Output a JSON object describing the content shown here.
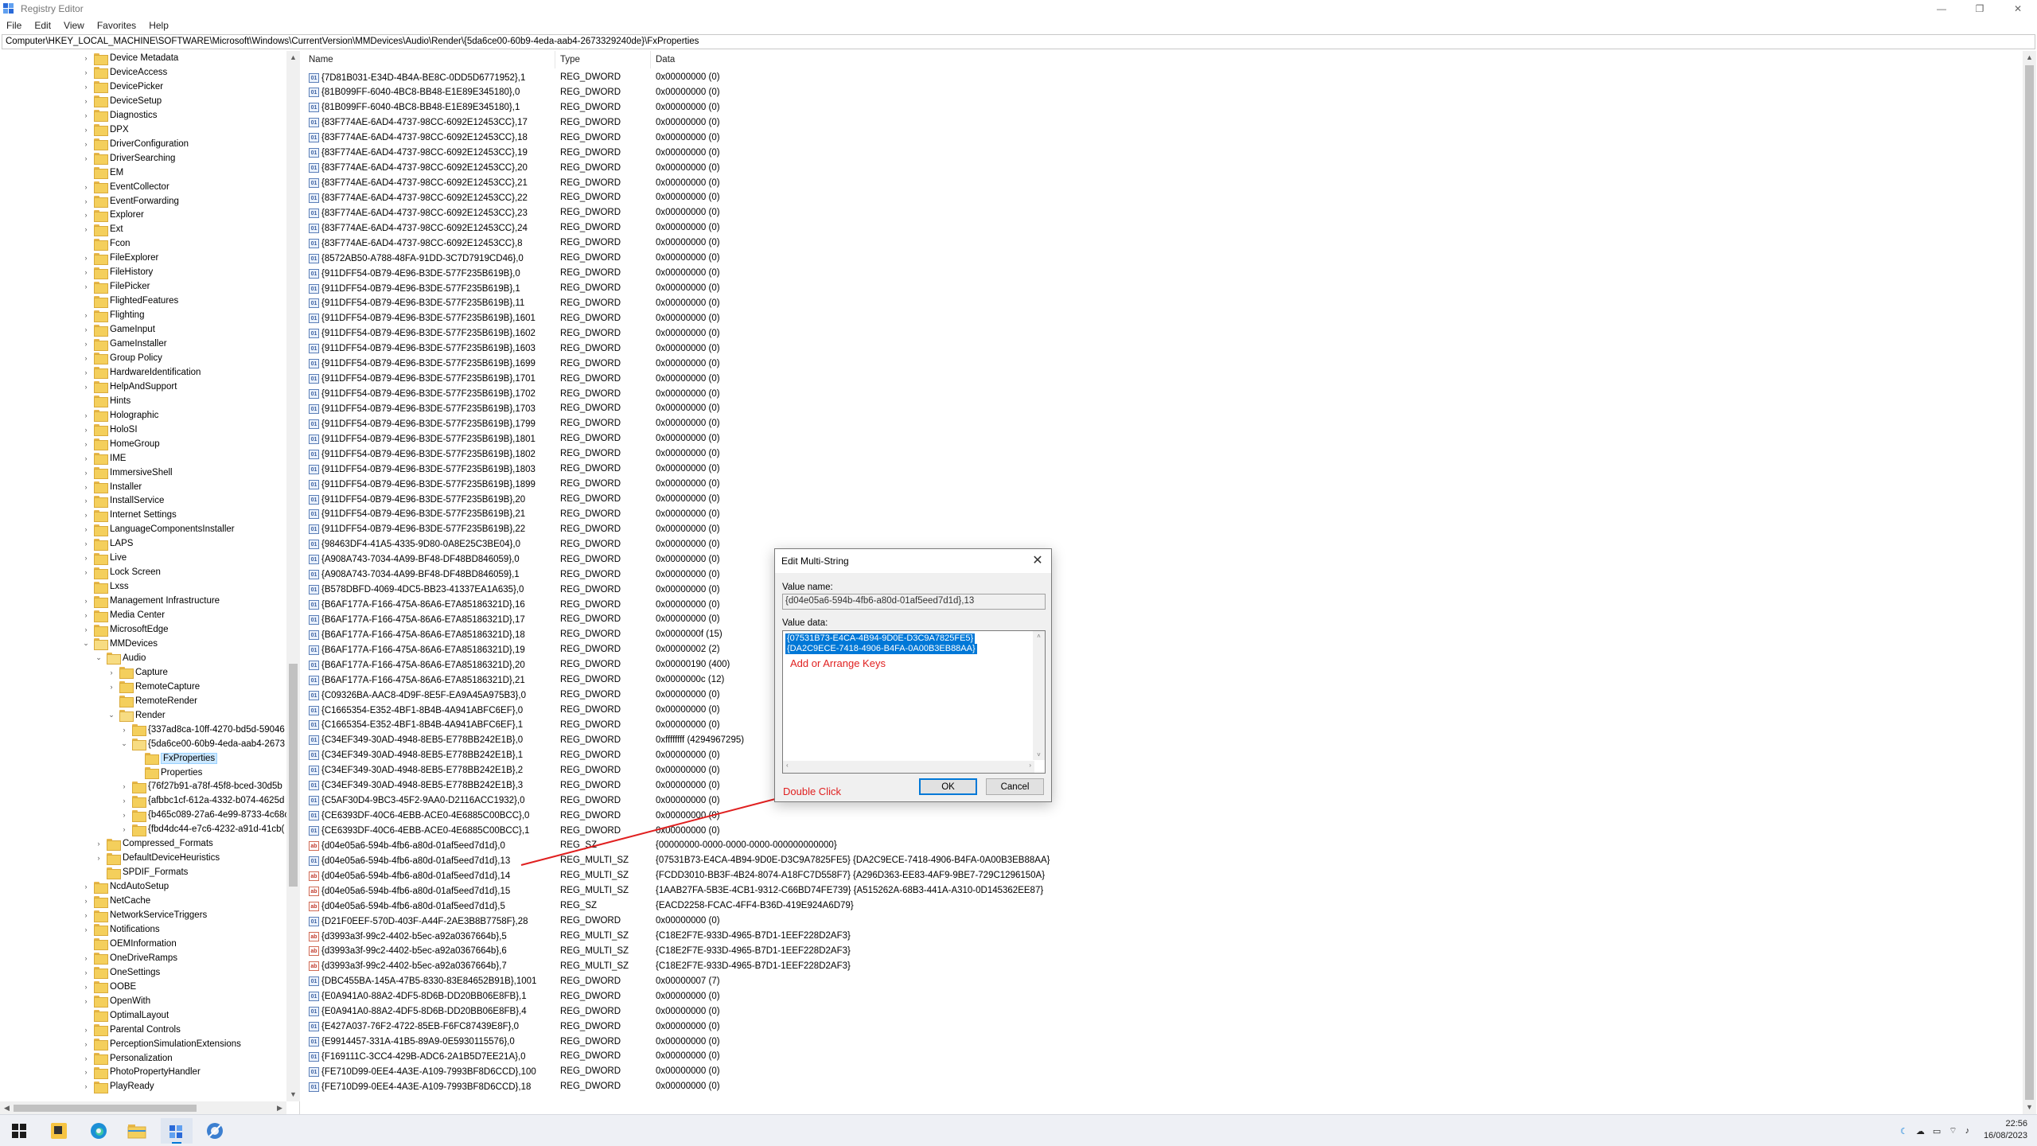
{
  "window": {
    "title": "Registry Editor",
    "controls": [
      "—",
      "❐",
      "✕"
    ]
  },
  "menu": [
    "File",
    "Edit",
    "View",
    "Favorites",
    "Help"
  ],
  "address": "Computer\\HKEY_LOCAL_MACHINE\\SOFTWARE\\Microsoft\\Windows\\CurrentVersion\\MMDevices\\Audio\\Render\\{5da6ce00-60b9-4eda-aab4-2673329240de}\\FxProperties",
  "tree": [
    {
      "label": "Device Metadata",
      "indent": 0,
      "arrow": "›"
    },
    {
      "label": "DeviceAccess",
      "indent": 0,
      "arrow": "›"
    },
    {
      "label": "DevicePicker",
      "indent": 0,
      "arrow": "›"
    },
    {
      "label": "DeviceSetup",
      "indent": 0,
      "arrow": "›"
    },
    {
      "label": "Diagnostics",
      "indent": 0,
      "arrow": "›"
    },
    {
      "label": "DPX",
      "indent": 0,
      "arrow": "›"
    },
    {
      "label": "DriverConfiguration",
      "indent": 0,
      "arrow": "›"
    },
    {
      "label": "DriverSearching",
      "indent": 0,
      "arrow": "›"
    },
    {
      "label": "EM",
      "indent": 0,
      "arrow": ""
    },
    {
      "label": "EventCollector",
      "indent": 0,
      "arrow": "›"
    },
    {
      "label": "EventForwarding",
      "indent": 0,
      "arrow": "›"
    },
    {
      "label": "Explorer",
      "indent": 0,
      "arrow": "›"
    },
    {
      "label": "Ext",
      "indent": 0,
      "arrow": "›"
    },
    {
      "label": "Fcon",
      "indent": 0,
      "arrow": ""
    },
    {
      "label": "FileExplorer",
      "indent": 0,
      "arrow": "›"
    },
    {
      "label": "FileHistory",
      "indent": 0,
      "arrow": "›"
    },
    {
      "label": "FilePicker",
      "indent": 0,
      "arrow": "›"
    },
    {
      "label": "FlightedFeatures",
      "indent": 0,
      "arrow": ""
    },
    {
      "label": "Flighting",
      "indent": 0,
      "arrow": "›"
    },
    {
      "label": "GameInput",
      "indent": 0,
      "arrow": "›"
    },
    {
      "label": "GameInstaller",
      "indent": 0,
      "arrow": "›"
    },
    {
      "label": "Group Policy",
      "indent": 0,
      "arrow": "›"
    },
    {
      "label": "HardwareIdentification",
      "indent": 0,
      "arrow": "›"
    },
    {
      "label": "HelpAndSupport",
      "indent": 0,
      "arrow": "›"
    },
    {
      "label": "Hints",
      "indent": 0,
      "arrow": ""
    },
    {
      "label": "Holographic",
      "indent": 0,
      "arrow": "›"
    },
    {
      "label": "HoloSI",
      "indent": 0,
      "arrow": "›"
    },
    {
      "label": "HomeGroup",
      "indent": 0,
      "arrow": "›"
    },
    {
      "label": "IME",
      "indent": 0,
      "arrow": "›"
    },
    {
      "label": "ImmersiveShell",
      "indent": 0,
      "arrow": "›"
    },
    {
      "label": "Installer",
      "indent": 0,
      "arrow": "›"
    },
    {
      "label": "InstallService",
      "indent": 0,
      "arrow": "›"
    },
    {
      "label": "Internet Settings",
      "indent": 0,
      "arrow": "›"
    },
    {
      "label": "LanguageComponentsInstaller",
      "indent": 0,
      "arrow": "›"
    },
    {
      "label": "LAPS",
      "indent": 0,
      "arrow": "›"
    },
    {
      "label": "Live",
      "indent": 0,
      "arrow": "›"
    },
    {
      "label": "Lock Screen",
      "indent": 0,
      "arrow": "›"
    },
    {
      "label": "Lxss",
      "indent": 0,
      "arrow": ""
    },
    {
      "label": "Management Infrastructure",
      "indent": 0,
      "arrow": "›"
    },
    {
      "label": "Media Center",
      "indent": 0,
      "arrow": "›"
    },
    {
      "label": "MicrosoftEdge",
      "indent": 0,
      "arrow": "›"
    },
    {
      "label": "MMDevices",
      "indent": 0,
      "arrow": "⌄",
      "open": true
    },
    {
      "label": "Audio",
      "indent": 1,
      "arrow": "⌄",
      "open": true
    },
    {
      "label": "Capture",
      "indent": 2,
      "arrow": "›"
    },
    {
      "label": "RemoteCapture",
      "indent": 2,
      "arrow": "›"
    },
    {
      "label": "RemoteRender",
      "indent": 2,
      "arrow": ""
    },
    {
      "label": "Render",
      "indent": 2,
      "arrow": "⌄",
      "open": true
    },
    {
      "label": "{337ad8ca-10ff-4270-bd5d-59046",
      "indent": 3,
      "arrow": "›"
    },
    {
      "label": "{5da6ce00-60b9-4eda-aab4-2673",
      "indent": 3,
      "arrow": "⌄",
      "open": true
    },
    {
      "label": "FxProperties",
      "indent": 4,
      "arrow": "",
      "selected": true
    },
    {
      "label": "Properties",
      "indent": 4,
      "arrow": ""
    },
    {
      "label": "{76f27b91-a78f-45f8-bced-30d5b",
      "indent": 3,
      "arrow": "›"
    },
    {
      "label": "{afbbc1cf-612a-4332-b074-4625d",
      "indent": 3,
      "arrow": "›"
    },
    {
      "label": "{b465c089-27a6-4e99-8733-4c68c",
      "indent": 3,
      "arrow": "›"
    },
    {
      "label": "{fbd4dc44-e7c6-4232-a91d-41cb(",
      "indent": 3,
      "arrow": "›"
    },
    {
      "label": "Compressed_Formats",
      "indent": 1,
      "arrow": "›"
    },
    {
      "label": "DefaultDeviceHeuristics",
      "indent": 1,
      "arrow": "›"
    },
    {
      "label": "SPDIF_Formats",
      "indent": 1,
      "arrow": ""
    },
    {
      "label": "NcdAutoSetup",
      "indent": 0,
      "arrow": "›"
    },
    {
      "label": "NetCache",
      "indent": 0,
      "arrow": "›"
    },
    {
      "label": "NetworkServiceTriggers",
      "indent": 0,
      "arrow": "›"
    },
    {
      "label": "Notifications",
      "indent": 0,
      "arrow": "›"
    },
    {
      "label": "OEMInformation",
      "indent": 0,
      "arrow": ""
    },
    {
      "label": "OneDriveRamps",
      "indent": 0,
      "arrow": "›"
    },
    {
      "label": "OneSettings",
      "indent": 0,
      "arrow": "›"
    },
    {
      "label": "OOBE",
      "indent": 0,
      "arrow": "›"
    },
    {
      "label": "OpenWith",
      "indent": 0,
      "arrow": "›"
    },
    {
      "label": "OptimalLayout",
      "indent": 0,
      "arrow": ""
    },
    {
      "label": "Parental Controls",
      "indent": 0,
      "arrow": "›"
    },
    {
      "label": "PerceptionSimulationExtensions",
      "indent": 0,
      "arrow": "›"
    },
    {
      "label": "Personalization",
      "indent": 0,
      "arrow": "›"
    },
    {
      "label": "PhotoPropertyHandler",
      "indent": 0,
      "arrow": "›"
    },
    {
      "label": "PlayReady",
      "indent": 0,
      "arrow": "›"
    }
  ],
  "values_header": {
    "name": "Name",
    "type": "Type",
    "data": "Data"
  },
  "values": [
    {
      "name": "{7D81B031-E34D-4B4A-BE8C-0DD5D6771952},1",
      "type": "REG_DWORD",
      "data": "0x00000000 (0)",
      "icon": "bin"
    },
    {
      "name": "{81B099FF-6040-4BC8-BB48-E1E89E345180},0",
      "type": "REG_DWORD",
      "data": "0x00000000 (0)",
      "icon": "bin"
    },
    {
      "name": "{81B099FF-6040-4BC8-BB48-E1E89E345180},1",
      "type": "REG_DWORD",
      "data": "0x00000000 (0)",
      "icon": "bin"
    },
    {
      "name": "{83F774AE-6AD4-4737-98CC-6092E12453CC},17",
      "type": "REG_DWORD",
      "data": "0x00000000 (0)",
      "icon": "bin"
    },
    {
      "name": "{83F774AE-6AD4-4737-98CC-6092E12453CC},18",
      "type": "REG_DWORD",
      "data": "0x00000000 (0)",
      "icon": "bin"
    },
    {
      "name": "{83F774AE-6AD4-4737-98CC-6092E12453CC},19",
      "type": "REG_DWORD",
      "data": "0x00000000 (0)",
      "icon": "bin"
    },
    {
      "name": "{83F774AE-6AD4-4737-98CC-6092E12453CC},20",
      "type": "REG_DWORD",
      "data": "0x00000000 (0)",
      "icon": "bin"
    },
    {
      "name": "{83F774AE-6AD4-4737-98CC-6092E12453CC},21",
      "type": "REG_DWORD",
      "data": "0x00000000 (0)",
      "icon": "bin"
    },
    {
      "name": "{83F774AE-6AD4-4737-98CC-6092E12453CC},22",
      "type": "REG_DWORD",
      "data": "0x00000000 (0)",
      "icon": "bin"
    },
    {
      "name": "{83F774AE-6AD4-4737-98CC-6092E12453CC},23",
      "type": "REG_DWORD",
      "data": "0x00000000 (0)",
      "icon": "bin"
    },
    {
      "name": "{83F774AE-6AD4-4737-98CC-6092E12453CC},24",
      "type": "REG_DWORD",
      "data": "0x00000000 (0)",
      "icon": "bin"
    },
    {
      "name": "{83F774AE-6AD4-4737-98CC-6092E12453CC},8",
      "type": "REG_DWORD",
      "data": "0x00000000 (0)",
      "icon": "bin"
    },
    {
      "name": "{8572AB50-A788-48FA-91DD-3C7D7919CD46},0",
      "type": "REG_DWORD",
      "data": "0x00000000 (0)",
      "icon": "bin"
    },
    {
      "name": "{911DFF54-0B79-4E96-B3DE-577F235B619B},0",
      "type": "REG_DWORD",
      "data": "0x00000000 (0)",
      "icon": "bin"
    },
    {
      "name": "{911DFF54-0B79-4E96-B3DE-577F235B619B},1",
      "type": "REG_DWORD",
      "data": "0x00000000 (0)",
      "icon": "bin"
    },
    {
      "name": "{911DFF54-0B79-4E96-B3DE-577F235B619B},11",
      "type": "REG_DWORD",
      "data": "0x00000000 (0)",
      "icon": "bin"
    },
    {
      "name": "{911DFF54-0B79-4E96-B3DE-577F235B619B},1601",
      "type": "REG_DWORD",
      "data": "0x00000000 (0)",
      "icon": "bin"
    },
    {
      "name": "{911DFF54-0B79-4E96-B3DE-577F235B619B},1602",
      "type": "REG_DWORD",
      "data": "0x00000000 (0)",
      "icon": "bin"
    },
    {
      "name": "{911DFF54-0B79-4E96-B3DE-577F235B619B},1603",
      "type": "REG_DWORD",
      "data": "0x00000000 (0)",
      "icon": "bin"
    },
    {
      "name": "{911DFF54-0B79-4E96-B3DE-577F235B619B},1699",
      "type": "REG_DWORD",
      "data": "0x00000000 (0)",
      "icon": "bin"
    },
    {
      "name": "{911DFF54-0B79-4E96-B3DE-577F235B619B},1701",
      "type": "REG_DWORD",
      "data": "0x00000000 (0)",
      "icon": "bin"
    },
    {
      "name": "{911DFF54-0B79-4E96-B3DE-577F235B619B},1702",
      "type": "REG_DWORD",
      "data": "0x00000000 (0)",
      "icon": "bin"
    },
    {
      "name": "{911DFF54-0B79-4E96-B3DE-577F235B619B},1703",
      "type": "REG_DWORD",
      "data": "0x00000000 (0)",
      "icon": "bin"
    },
    {
      "name": "{911DFF54-0B79-4E96-B3DE-577F235B619B},1799",
      "type": "REG_DWORD",
      "data": "0x00000000 (0)",
      "icon": "bin"
    },
    {
      "name": "{911DFF54-0B79-4E96-B3DE-577F235B619B},1801",
      "type": "REG_DWORD",
      "data": "0x00000000 (0)",
      "icon": "bin"
    },
    {
      "name": "{911DFF54-0B79-4E96-B3DE-577F235B619B},1802",
      "type": "REG_DWORD",
      "data": "0x00000000 (0)",
      "icon": "bin"
    },
    {
      "name": "{911DFF54-0B79-4E96-B3DE-577F235B619B},1803",
      "type": "REG_DWORD",
      "data": "0x00000000 (0)",
      "icon": "bin"
    },
    {
      "name": "{911DFF54-0B79-4E96-B3DE-577F235B619B},1899",
      "type": "REG_DWORD",
      "data": "0x00000000 (0)",
      "icon": "bin"
    },
    {
      "name": "{911DFF54-0B79-4E96-B3DE-577F235B619B},20",
      "type": "REG_DWORD",
      "data": "0x00000000 (0)",
      "icon": "bin"
    },
    {
      "name": "{911DFF54-0B79-4E96-B3DE-577F235B619B},21",
      "type": "REG_DWORD",
      "data": "0x00000000 (0)",
      "icon": "bin"
    },
    {
      "name": "{911DFF54-0B79-4E96-B3DE-577F235B619B},22",
      "type": "REG_DWORD",
      "data": "0x00000000 (0)",
      "icon": "bin"
    },
    {
      "name": "{98463DF4-41A5-4335-9D80-0A8E25C3BE04},0",
      "type": "REG_DWORD",
      "data": "0x00000000 (0)",
      "icon": "bin"
    },
    {
      "name": "{A908A743-7034-4A99-BF48-DF48BD846059},0",
      "type": "REG_DWORD",
      "data": "0x00000000 (0)",
      "icon": "bin"
    },
    {
      "name": "{A908A743-7034-4A99-BF48-DF48BD846059},1",
      "type": "REG_DWORD",
      "data": "0x00000000 (0)",
      "icon": "bin"
    },
    {
      "name": "{B578DBFD-4069-4DC5-BB23-41337EA1A635},0",
      "type": "REG_DWORD",
      "data": "0x00000000 (0)",
      "icon": "bin"
    },
    {
      "name": "{B6AF177A-F166-475A-86A6-E7A85186321D},16",
      "type": "REG_DWORD",
      "data": "0x00000000 (0)",
      "icon": "bin"
    },
    {
      "name": "{B6AF177A-F166-475A-86A6-E7A85186321D},17",
      "type": "REG_DWORD",
      "data": "0x00000000 (0)",
      "icon": "bin"
    },
    {
      "name": "{B6AF177A-F166-475A-86A6-E7A85186321D},18",
      "type": "REG_DWORD",
      "data": "0x0000000f (15)",
      "icon": "bin"
    },
    {
      "name": "{B6AF177A-F166-475A-86A6-E7A85186321D},19",
      "type": "REG_DWORD",
      "data": "0x00000002 (2)",
      "icon": "bin"
    },
    {
      "name": "{B6AF177A-F166-475A-86A6-E7A85186321D},20",
      "type": "REG_DWORD",
      "data": "0x00000190 (400)",
      "icon": "bin"
    },
    {
      "name": "{B6AF177A-F166-475A-86A6-E7A85186321D},21",
      "type": "REG_DWORD",
      "data": "0x0000000c (12)",
      "icon": "bin"
    },
    {
      "name": "{C09326BA-AAC8-4D9F-8E5F-EA9A45A975B3},0",
      "type": "REG_DWORD",
      "data": "0x00000000 (0)",
      "icon": "bin"
    },
    {
      "name": "{C1665354-E352-4BF1-8B4B-4A941ABFC6EF},0",
      "type": "REG_DWORD",
      "data": "0x00000000 (0)",
      "icon": "bin"
    },
    {
      "name": "{C1665354-E352-4BF1-8B4B-4A941ABFC6EF},1",
      "type": "REG_DWORD",
      "data": "0x00000000 (0)",
      "icon": "bin"
    },
    {
      "name": "{C34EF349-30AD-4948-8EB5-E778BB242E1B},0",
      "type": "REG_DWORD",
      "data": "0xffffffff (4294967295)",
      "icon": "bin"
    },
    {
      "name": "{C34EF349-30AD-4948-8EB5-E778BB242E1B},1",
      "type": "REG_DWORD",
      "data": "0x00000000 (0)",
      "icon": "bin"
    },
    {
      "name": "{C34EF349-30AD-4948-8EB5-E778BB242E1B},2",
      "type": "REG_DWORD",
      "data": "0x00000000 (0)",
      "icon": "bin"
    },
    {
      "name": "{C34EF349-30AD-4948-8EB5-E778BB242E1B},3",
      "type": "REG_DWORD",
      "data": "0x00000000 (0)",
      "icon": "bin"
    },
    {
      "name": "{C5AF30D4-9BC3-45F2-9AA0-D2116ACC1932},0",
      "type": "REG_DWORD",
      "data": "0x00000000 (0)",
      "icon": "bin"
    },
    {
      "name": "{CE6393DF-40C6-4EBB-ACE0-4E6885C00BCC},0",
      "type": "REG_DWORD",
      "data": "0x00000000 (0)",
      "icon": "bin"
    },
    {
      "name": "{CE6393DF-40C6-4EBB-ACE0-4E6885C00BCC},1",
      "type": "REG_DWORD",
      "data": "0x00000000 (0)",
      "icon": "bin"
    },
    {
      "name": "{d04e05a6-594b-4fb6-a80d-01af5eed7d1d},0",
      "type": "REG_SZ",
      "data": "{00000000-0000-0000-0000-000000000000}",
      "icon": "str"
    },
    {
      "name": "{d04e05a6-594b-4fb6-a80d-01af5eed7d1d},13",
      "type": "REG_MULTI_SZ",
      "data": "{07531B73-E4CA-4B94-9D0E-D3C9A7825FE5} {DA2C9ECE-7418-4906-B4FA-0A00B3EB88AA}",
      "icon": "bin"
    },
    {
      "name": "{d04e05a6-594b-4fb6-a80d-01af5eed7d1d},14",
      "type": "REG_MULTI_SZ",
      "data": "{FCDD3010-BB3F-4B24-8074-A18FC7D558F7} {A296D363-EE83-4AF9-9BE7-729C1296150A}",
      "icon": "str"
    },
    {
      "name": "{d04e05a6-594b-4fb6-a80d-01af5eed7d1d},15",
      "type": "REG_MULTI_SZ",
      "data": "{1AAB27FA-5B3E-4CB1-9312-C66BD74FE739} {A515262A-68B3-441A-A310-0D145362EE87}",
      "icon": "str"
    },
    {
      "name": "{d04e05a6-594b-4fb6-a80d-01af5eed7d1d},5",
      "type": "REG_SZ",
      "data": "{EACD2258-FCAC-4FF4-B36D-419E924A6D79}",
      "icon": "str"
    },
    {
      "name": "{D21F0EEF-570D-403F-A44F-2AE3B8B7758F},28",
      "type": "REG_DWORD",
      "data": "0x00000000 (0)",
      "icon": "bin"
    },
    {
      "name": "{d3993a3f-99c2-4402-b5ec-a92a0367664b},5",
      "type": "REG_MULTI_SZ",
      "data": "{C18E2F7E-933D-4965-B7D1-1EEF228D2AF3}",
      "icon": "str"
    },
    {
      "name": "{d3993a3f-99c2-4402-b5ec-a92a0367664b},6",
      "type": "REG_MULTI_SZ",
      "data": "{C18E2F7E-933D-4965-B7D1-1EEF228D2AF3}",
      "icon": "str"
    },
    {
      "name": "{d3993a3f-99c2-4402-b5ec-a92a0367664b},7",
      "type": "REG_MULTI_SZ",
      "data": "{C18E2F7E-933D-4965-B7D1-1EEF228D2AF3}",
      "icon": "str"
    },
    {
      "name": "{DBC455BA-145A-47B5-8330-83E84652B91B},1001",
      "type": "REG_DWORD",
      "data": "0x00000007 (7)",
      "icon": "bin"
    },
    {
      "name": "{E0A941A0-88A2-4DF5-8D6B-DD20BB06E8FB},1",
      "type": "REG_DWORD",
      "data": "0x00000000 (0)",
      "icon": "bin"
    },
    {
      "name": "{E0A941A0-88A2-4DF5-8D6B-DD20BB06E8FB},4",
      "type": "REG_DWORD",
      "data": "0x00000000 (0)",
      "icon": "bin"
    },
    {
      "name": "{E427A037-76F2-4722-85EB-F6FC87439E8F},0",
      "type": "REG_DWORD",
      "data": "0x00000000 (0)",
      "icon": "bin"
    },
    {
      "name": "{E9914457-331A-41B5-89A9-0E5930115576},0",
      "type": "REG_DWORD",
      "data": "0x00000000 (0)",
      "icon": "bin"
    },
    {
      "name": "{F169111C-3CC4-429B-ADC6-2A1B5D7EE21A},0",
      "type": "REG_DWORD",
      "data": "0x00000000 (0)",
      "icon": "bin"
    },
    {
      "name": "{FE710D99-0EE4-4A3E-A109-7993BF8D6CCD},100",
      "type": "REG_DWORD",
      "data": "0x00000000 (0)",
      "icon": "bin"
    },
    {
      "name": "{FE710D99-0EE4-4A3E-A109-7993BF8D6CCD},18",
      "type": "REG_DWORD",
      "data": "0x00000000 (0)",
      "icon": "bin"
    }
  ],
  "dialog": {
    "title": "Edit Multi-String",
    "value_name_label": "Value name:",
    "value_name": "{d04e05a6-594b-4fb6-a80d-01af5eed7d1d},13",
    "value_data_label": "Value data:",
    "value_data_lines": [
      "{07531B73-E4CA-4B94-9D0E-D3C9A7825FE5}",
      "{DA2C9ECE-7418-4906-B4FA-0A00B3EB88AA}"
    ],
    "ok_label": "OK",
    "cancel_label": "Cancel"
  },
  "annotations": {
    "arrange_keys": "Add or Arrange Keys",
    "double_click": "Double Click",
    "color": "#e02020"
  },
  "taskbar": {
    "time": "22:56",
    "date": "16/08/2023",
    "accent": "#0078d7"
  }
}
